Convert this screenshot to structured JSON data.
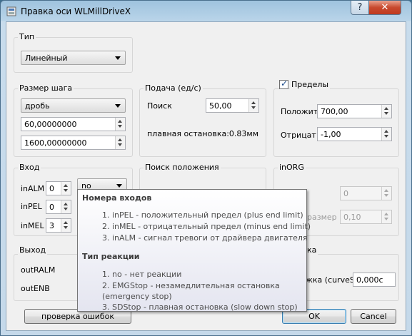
{
  "window": {
    "title": "Правка оси  WLMillDriveX",
    "help_glyph": "?",
    "close_glyph": "✕"
  },
  "type_group": {
    "title": "Тип",
    "value": "Линейный"
  },
  "step_group": {
    "title": "Размер шага",
    "mode": "дробь",
    "numerator": "60,00000000",
    "denominator": "1600,00000000"
  },
  "feed_group": {
    "title": "Подача (ед/с)",
    "search_label": "Поиск",
    "search_value": "50,00",
    "smooth_stop_text": "плавная остановка:0.83мм"
  },
  "limits_group": {
    "title": "Пределы",
    "checked": true,
    "positive_label": "Положит",
    "positive_value": "700,00",
    "negative_label": "Отрицат",
    "negative_value": "-1,00"
  },
  "input_group": {
    "title": "Вход",
    "rows": [
      {
        "label": "inALM",
        "value": "0",
        "combo": "no"
      },
      {
        "label": "inPEL",
        "value": "0"
      },
      {
        "label": "inMEL",
        "value": "3"
      }
    ]
  },
  "search_pos_group": {
    "title": "Поиск положения"
  },
  "inorg_group": {
    "title": "inORG",
    "first_value": "0",
    "size_label": "размер",
    "size_value": "0,10"
  },
  "output_group": {
    "title": "Выход",
    "rows": [
      "outRALM",
      "outENB"
    ]
  },
  "curve_group": {
    "title_fragment": "ка",
    "curve_label": "жка (curveS)",
    "curve_value": "0,000c"
  },
  "tooltip": {
    "heading1": "Номера входов",
    "items1": [
      "1. inPEL - положительный предел (plus end limit)",
      "2. inMEL - отрицательный предел (minus end limit)",
      "3. inALM - сигнал тревоги от драйвера двигателя"
    ],
    "heading2": "Тип реакции",
    "items2": [
      "1. no - нет реакции",
      "2. EMGStop - незамедлительная остановка",
      "(emergency stop)",
      "3. SDStop - плавная остановка (slow down stop)"
    ]
  },
  "buttons": {
    "check_errors": "проверка ошибок",
    "ok": "OK",
    "cancel": "Cancel"
  }
}
